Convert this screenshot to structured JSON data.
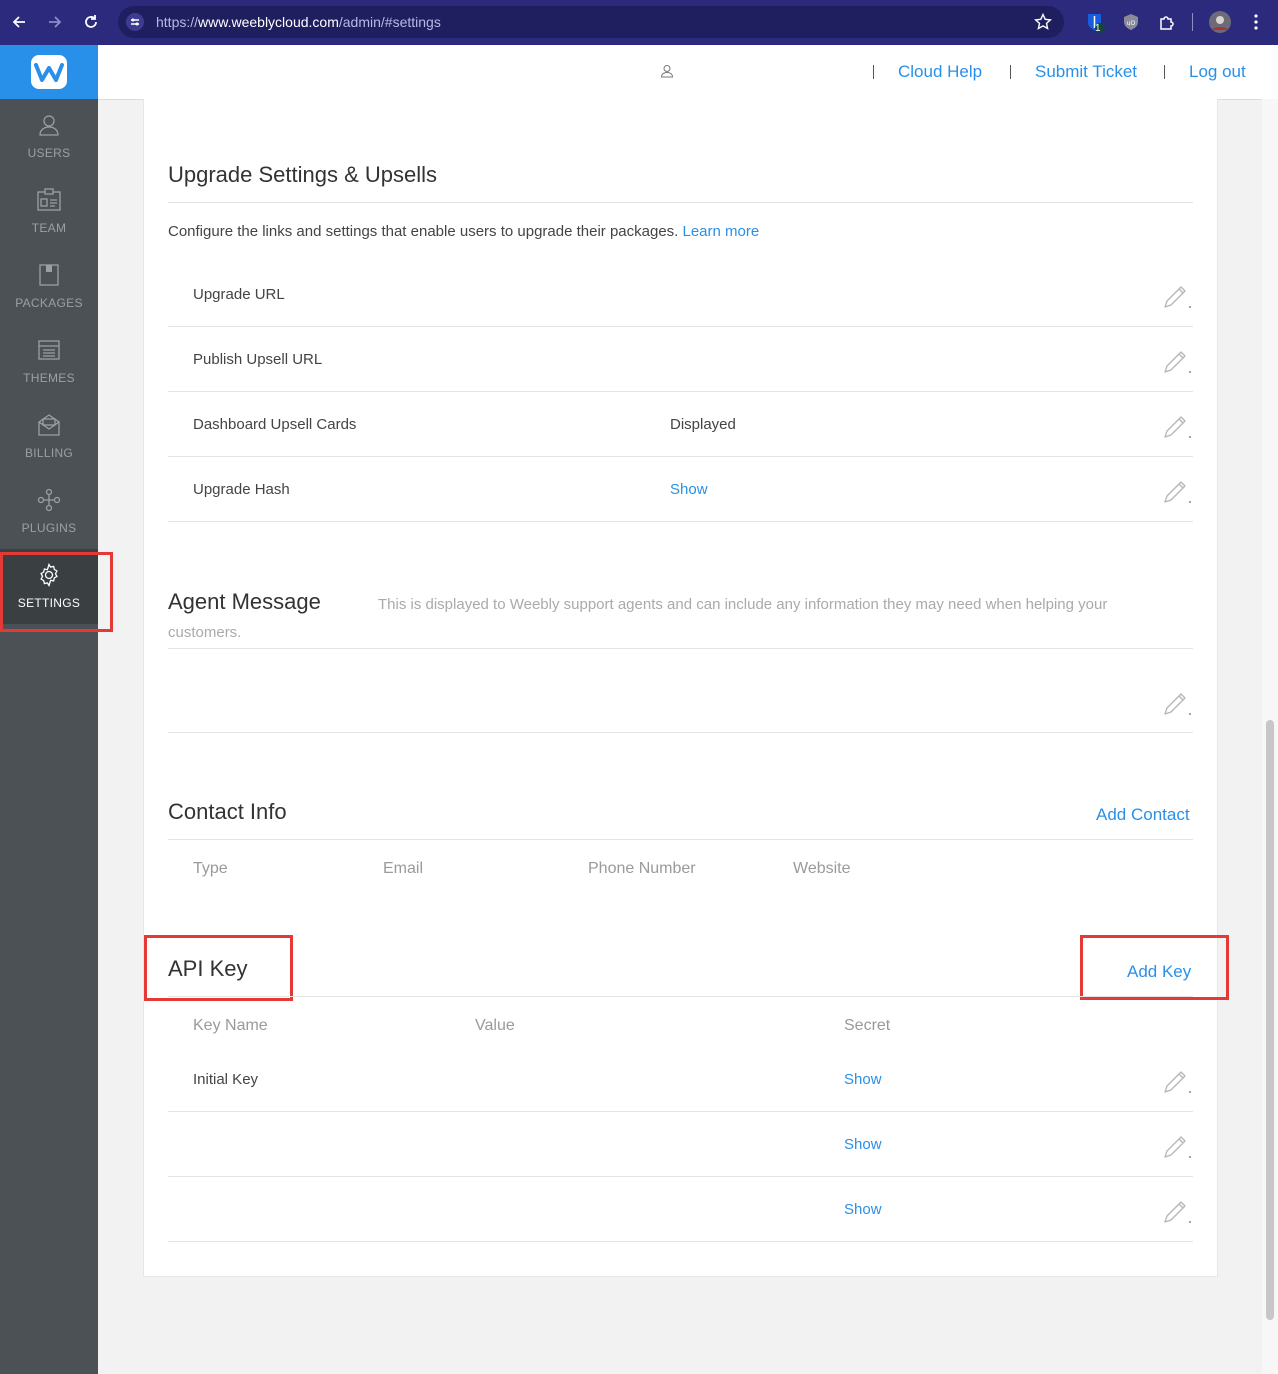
{
  "browser": {
    "url_scheme": "https://",
    "url_host": "www.weeblycloud.com",
    "url_path": "/admin/#settings",
    "extension_badge": "1"
  },
  "header": {
    "links": [
      "Cloud Help",
      "Submit Ticket",
      "Log out"
    ]
  },
  "sidebar": {
    "items": [
      {
        "label": "USERS",
        "icon": "user-icon"
      },
      {
        "label": "TEAM",
        "icon": "id-card-icon"
      },
      {
        "label": "PACKAGES",
        "icon": "package-icon"
      },
      {
        "label": "THEMES",
        "icon": "layout-icon"
      },
      {
        "label": "BILLING",
        "icon": "envelope-icon"
      },
      {
        "label": "PLUGINS",
        "icon": "plugin-icon"
      },
      {
        "label": "SETTINGS",
        "icon": "gear-icon",
        "active": true
      }
    ]
  },
  "upgrade": {
    "title": "Upgrade Settings & Upsells",
    "description": "Configure the links and settings that enable users to upgrade their packages.",
    "learn_more": "Learn more",
    "rows": [
      {
        "label": "Upgrade URL",
        "value": "",
        "is_link": false
      },
      {
        "label": "Publish Upsell URL",
        "value": "",
        "is_link": false
      },
      {
        "label": "Dashboard Upsell Cards",
        "value": "Displayed",
        "is_link": false
      },
      {
        "label": "Upgrade Hash",
        "value": "Show",
        "is_link": true
      }
    ]
  },
  "agent": {
    "title": "Agent Message",
    "note_line1": "This is displayed to Weebly support agents and can include any information they may need when helping your",
    "note_line2": "customers."
  },
  "contact": {
    "title": "Contact Info",
    "add_label": "Add Contact",
    "columns": [
      "Type",
      "Email",
      "Phone Number",
      "Website"
    ]
  },
  "api": {
    "title": "API Key",
    "add_label": "Add Key",
    "columns": [
      "Key Name",
      "Value",
      "Secret"
    ],
    "rows": [
      {
        "name": "Initial Key",
        "value": "",
        "secret": "Show"
      },
      {
        "name": "",
        "value": "",
        "secret": "Show"
      },
      {
        "name": "",
        "value": "",
        "secret": "Show"
      }
    ]
  },
  "colors": {
    "accent": "#2990ea",
    "browser_bar": "#2b2a7c",
    "sidebar": "#4b5154",
    "highlight": "#e53935"
  }
}
